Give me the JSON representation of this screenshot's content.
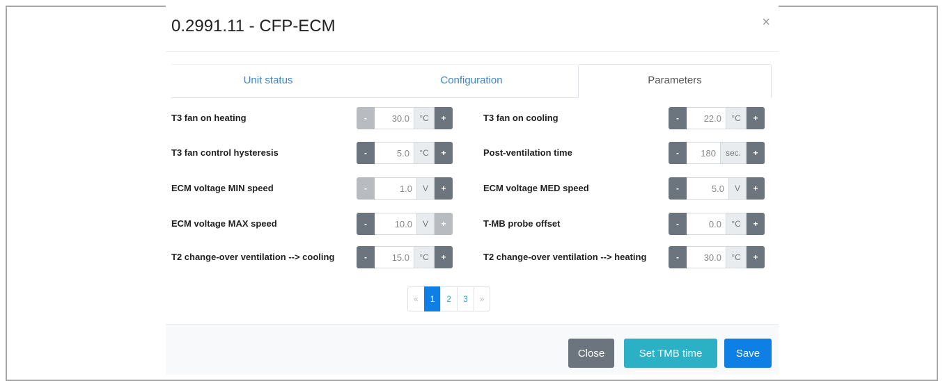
{
  "modal": {
    "title": "0.2991.11 - CFP-ECM",
    "close_symbol": "×"
  },
  "tabs": [
    {
      "label": "Unit status",
      "active": false
    },
    {
      "label": "Configuration",
      "active": false
    },
    {
      "label": "Parameters",
      "active": true
    }
  ],
  "parameters": [
    {
      "label": "T3 fan on heating",
      "value": "30.0",
      "unit": "°C"
    },
    {
      "label": "T3 fan on cooling",
      "value": "22.0",
      "unit": "°C"
    },
    {
      "label": "T3 fan control hysteresis",
      "value": "5.0",
      "unit": "°C"
    },
    {
      "label": "Post-ventilation time",
      "value": "180",
      "unit": "sec."
    },
    {
      "label": "ECM voltage MIN speed",
      "value": "1.0",
      "unit": "V"
    },
    {
      "label": "ECM voltage MED speed",
      "value": "5.0",
      "unit": "V"
    },
    {
      "label": "ECM voltage MAX speed",
      "value": "10.0",
      "unit": "V"
    },
    {
      "label": "T-MB probe offset",
      "value": "0.0",
      "unit": "°C"
    },
    {
      "label": "T2 change-over ventilation --> cooling",
      "value": "15.0",
      "unit": "°C"
    },
    {
      "label": "T2 change-over ventilation --> heating",
      "value": "30.0",
      "unit": "°C"
    }
  ],
  "stepper": {
    "minus": "-",
    "plus": "+"
  },
  "pagination": {
    "prev": "«",
    "pages": [
      "1",
      "2",
      "3"
    ],
    "next": "»",
    "current": "1"
  },
  "footer": {
    "close": "Close",
    "set_tmb": "Set TMB time",
    "save": "Save"
  },
  "colors": {
    "primary": "#0d7fe5",
    "secondary": "#6c757d",
    "info": "#2bb0c5",
    "link": "#3a86c8"
  }
}
